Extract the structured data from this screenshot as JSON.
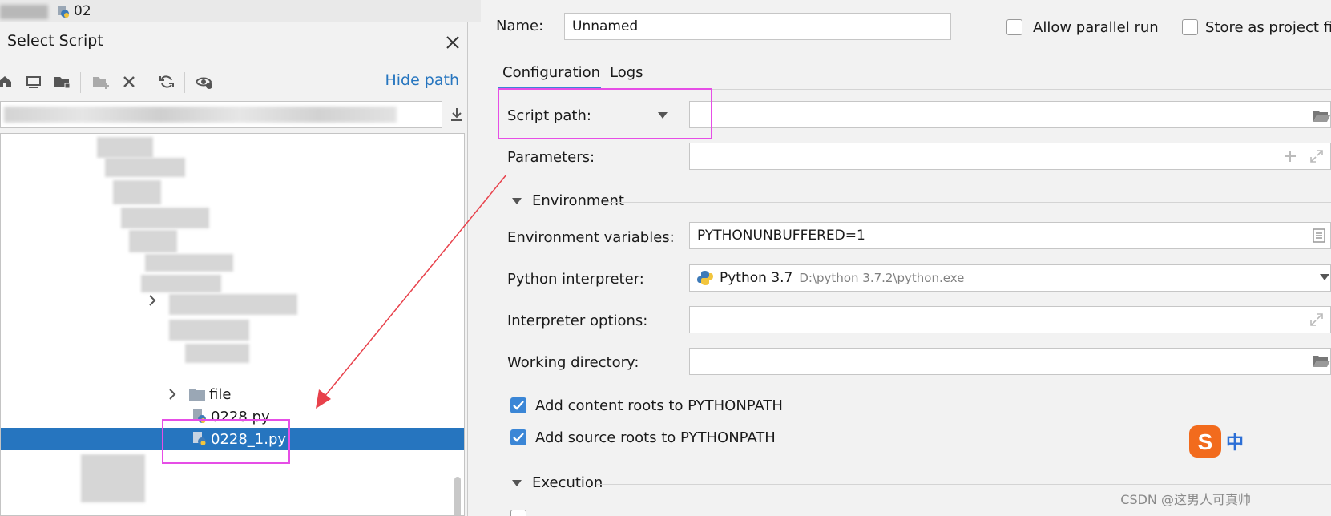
{
  "behind": {
    "tab_label": "02"
  },
  "dialog": {
    "title": "Select Script",
    "hide_path": "Hide path",
    "tree": {
      "folder_file": "file",
      "item_1": "0228.py",
      "item_2_selected": "0228_1.py"
    }
  },
  "config": {
    "name_label": "Name:",
    "name_value": "Unnamed",
    "allow_parallel": "Allow parallel run",
    "store_as_project": "Store as project fil",
    "tabs": [
      "Configuration",
      "Logs"
    ],
    "script_path_label": "Script path:",
    "parameters_label": "Parameters:",
    "environment_section": "Environment",
    "env_vars_label": "Environment variables:",
    "env_vars_value": "PYTHONUNBUFFERED=1",
    "interpreter_label": "Python interpreter:",
    "interpreter_name": "Python 3.7",
    "interpreter_path": "D:\\python 3.7.2\\python.exe",
    "interp_options_label": "Interpreter options:",
    "working_dir_label": "Working directory:",
    "add_content_roots": "Add content roots to PYTHONPATH",
    "add_source_roots": "Add source roots to PYTHONPATH",
    "execution_section": "Execution"
  },
  "ime": {
    "label": "中"
  },
  "watermark": "CSDN @这男人可真帅",
  "colors": {
    "accent": "#2675bf",
    "highlight": "#e64ee6",
    "arrow": "#e8414b"
  }
}
